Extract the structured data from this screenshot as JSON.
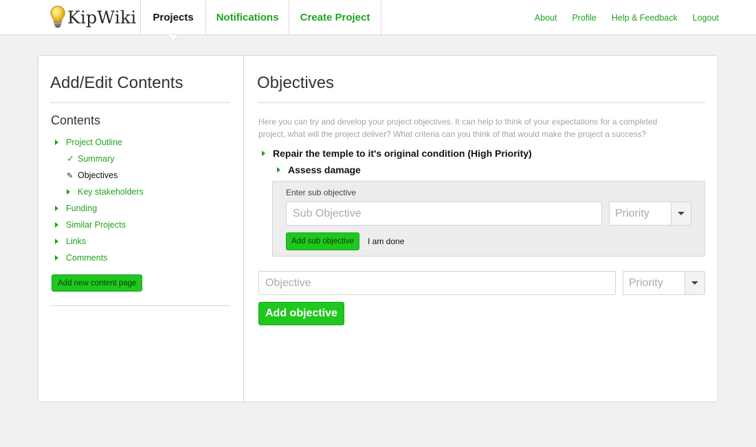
{
  "app": {
    "name": "KipWiki"
  },
  "nav": {
    "tabs": [
      {
        "label": "Projects",
        "active": true
      },
      {
        "label": "Notifications"
      },
      {
        "label": "Create Project"
      }
    ],
    "links": [
      "About",
      "Profile",
      "Help & Feedback",
      "Logout"
    ]
  },
  "sidebar": {
    "title": "Add/Edit Contents",
    "contents_heading": "Contents",
    "items": [
      {
        "label": "Project Outline",
        "icon": "triangle-right-icon"
      },
      {
        "label": "Summary",
        "icon": "check-icon"
      },
      {
        "label": "Objectives",
        "icon": "pencil-icon",
        "current": true
      },
      {
        "label": "Key stakeholders",
        "icon": "triangle-right-icon"
      },
      {
        "label": "Funding",
        "icon": "triangle-right-icon"
      },
      {
        "label": "Similar Projects",
        "icon": "triangle-right-icon"
      },
      {
        "label": "Links",
        "icon": "triangle-right-icon"
      },
      {
        "label": "Comments",
        "icon": "triangle-right-icon"
      }
    ],
    "add_page_label": "Add new content page"
  },
  "main": {
    "title": "Objectives",
    "intro_line1": "Here you can try and develop your project objectives. It can help to think of your expectations for a completed",
    "intro_line2": "project, what will the project deliver? What criteria can you think of that would make the project a success?",
    "objective": "Repair the temple to it's original condition (High Priority)",
    "sub_objective": "Assess damage",
    "sub_form": {
      "label": "Enter sub objective",
      "input_placeholder": "Sub Objective",
      "priority_placeholder": "Priority",
      "add_label": "Add sub objective",
      "done_label": "I am done"
    },
    "objective_form": {
      "input_placeholder": "Objective",
      "priority_placeholder": "Priority",
      "add_label": "Add objective"
    }
  },
  "colors": {
    "accent_green": "#1ea31e",
    "button_green": "#1ec81e",
    "background": "#f1f1f1"
  }
}
